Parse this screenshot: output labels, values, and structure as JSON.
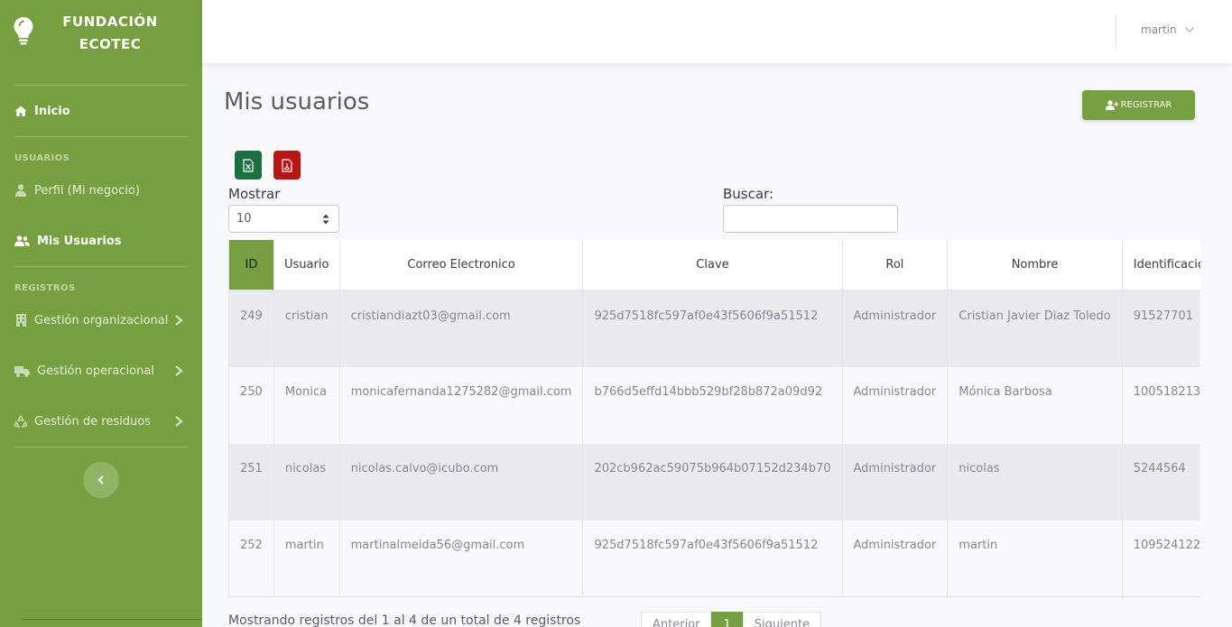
{
  "brand": {
    "line1": "FUNDACIÓN",
    "line2": "ECOTEC",
    "icon": "lightbulb-icon"
  },
  "sidebar": {
    "inicio": "Inicio",
    "heading_usuarios": "USUARIOS",
    "perfil": "Perfil (Mi negocio)",
    "mis_usuarios": "Mis Usuarios",
    "heading_registros": "REGISTROS",
    "gestion_organizacional": "Gestión organizacional",
    "gestion_operacional": "Gestión operacional",
    "gestion_residuos": "Gestión de residuos"
  },
  "topbar": {
    "user": "martin"
  },
  "page": {
    "title": "Mis usuarios",
    "register_label": "REGISTRAR",
    "show_label": "Mostrar",
    "show_value": "10",
    "search_label": "Buscar:",
    "search_value": ""
  },
  "table": {
    "headers": [
      "ID",
      "Usuario",
      "Correo Electronico",
      "Clave",
      "Rol",
      "Nombre",
      "Identificacio"
    ],
    "rows": [
      [
        "249",
        "cristian",
        "cristiandiazt03@gmail.com",
        "925d7518fc597af0e43f5606f9a51512",
        "Administrador",
        "Cristian Javier Diaz Toledo",
        "91527701"
      ],
      [
        "250",
        "Monica",
        "monicafernanda1275282@gmail.com",
        "b766d5effd14bbb529bf28b872a09d92",
        "Administrador",
        "Mónica Barbosa",
        "100518213"
      ],
      [
        "251",
        "nicolas",
        "nicolas.calvo@icubo.com",
        "202cb962ac59075b964b07152d234b70",
        "Administrador",
        "nicolas",
        "5244564"
      ],
      [
        "252",
        "martin",
        "martinalmeida56@gmail.com",
        "925d7518fc597af0e43f5606f9a51512",
        "Administrador",
        "martin",
        "109524122"
      ]
    ]
  },
  "footer": {
    "info": "Mostrando registros del 1 al 4 de un total de 4 registros",
    "prev": "Anterior",
    "page": "1",
    "next": "Siguiente"
  },
  "colors": {
    "accent": "#76a03f",
    "excel": "#1d6f42",
    "pdf": "#b81515"
  }
}
